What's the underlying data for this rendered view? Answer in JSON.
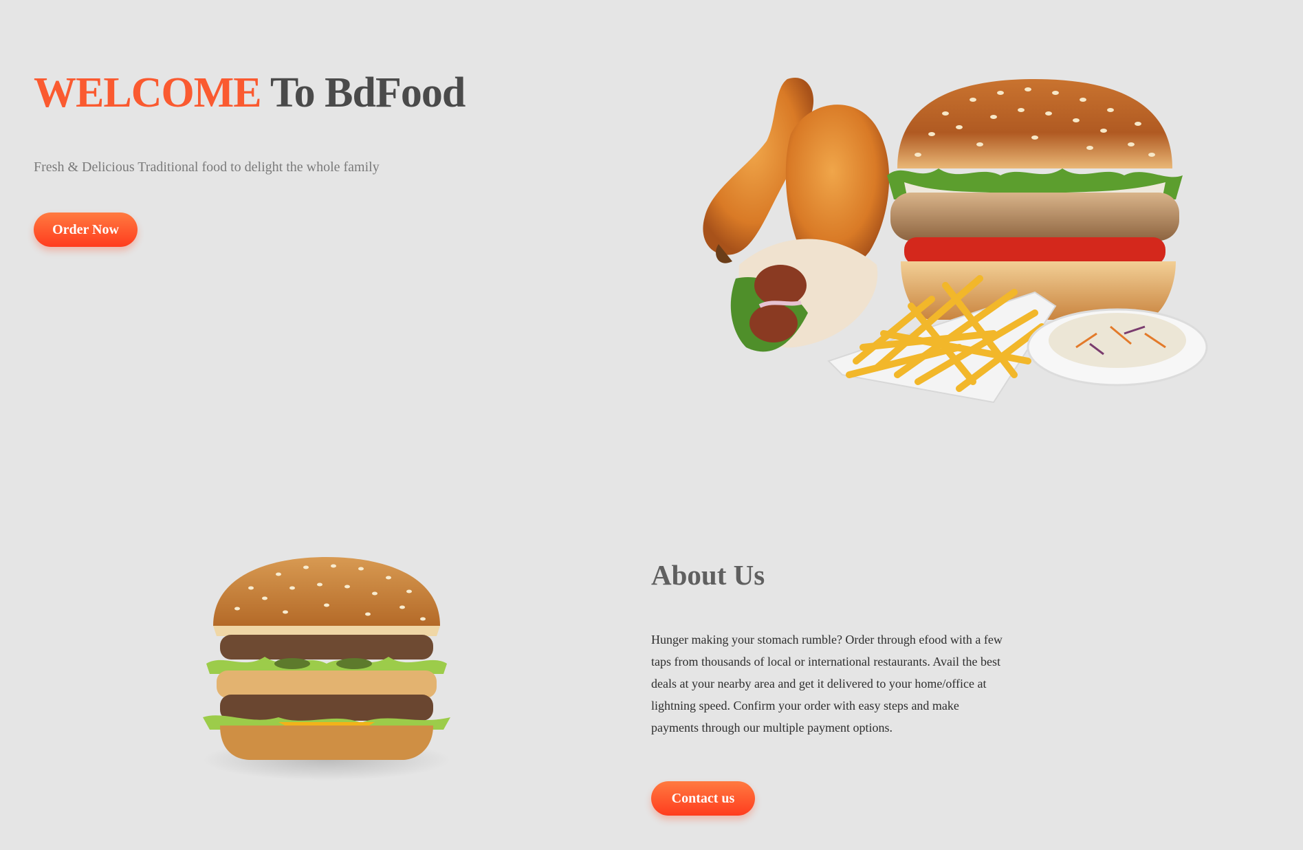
{
  "hero": {
    "title_accent": "WELCOME",
    "title_rest": " To BdFood",
    "subtitle": "Fresh & Delicious Traditional food to delight the whole family",
    "order_button": "Order Now"
  },
  "about": {
    "title": "About Us",
    "text": "Hunger making your stomach rumble? Order through efood with a few taps from thousands of local or international restaurants. Avail the best deals at your nearby area and get it delivered to your home/office at lightning speed. Confirm your order with easy steps and make payments through our multiple payment options.",
    "contact_button": "Contact us"
  },
  "images": {
    "hero": "food-platter-image",
    "about": "burger-image"
  },
  "colors": {
    "accent": "#fa5a30",
    "background": "#e5e5e5",
    "heading": "#4a4a4a"
  }
}
